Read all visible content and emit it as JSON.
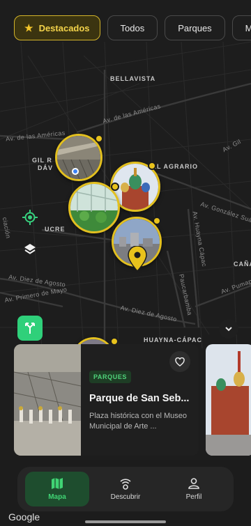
{
  "filters": [
    {
      "label": "Destacados",
      "icon": "star-icon",
      "active": true
    },
    {
      "label": "Todos",
      "active": false
    },
    {
      "label": "Parques",
      "active": false
    },
    {
      "label": "Muse",
      "active": false
    }
  ],
  "map_labels": {
    "bellavista": "BELLAVISTA",
    "av_americas": "Av. de las Américas",
    "av_americas_left": "Av. de las Américas",
    "gil_r": "GIL R",
    "dav": "DÁV",
    "el_agrario": "EL AGRARIO",
    "av_gil": "Av. Gil",
    "av_gonzalez": "Av. González Suár",
    "ucre": "UCRE",
    "av_huayna": "Av. Huayna Cápac",
    "canas": "CAÑA",
    "av_diez_left": "Av. Diez de Agosto",
    "av_primero": "Av. Primero de Mayo",
    "paucarbamba": "Paucarbamba",
    "av_diez": "Av. Diez de Agosto",
    "av_pumap": "Av. Pumap",
    "huayna_capac": "HUAYNA-CÁPAC",
    "ciacion": "ciación"
  },
  "cards": [
    {
      "badge": "PARQUES",
      "title": "Parque de San Seb...",
      "description": "Plaza histórica con el Museo Municipal de Arte ..."
    }
  ],
  "nav": [
    {
      "label": "Mapa",
      "icon": "map-icon",
      "active": true
    },
    {
      "label": "Descubrir",
      "icon": "discover-icon",
      "active": false
    },
    {
      "label": "Perfil",
      "icon": "profile-icon",
      "active": false
    }
  ],
  "google_logo": "Google",
  "colors": {
    "accent_yellow": "#e3c01f",
    "accent_green": "#2fd07a",
    "map_bg": "#1c1c1c"
  }
}
